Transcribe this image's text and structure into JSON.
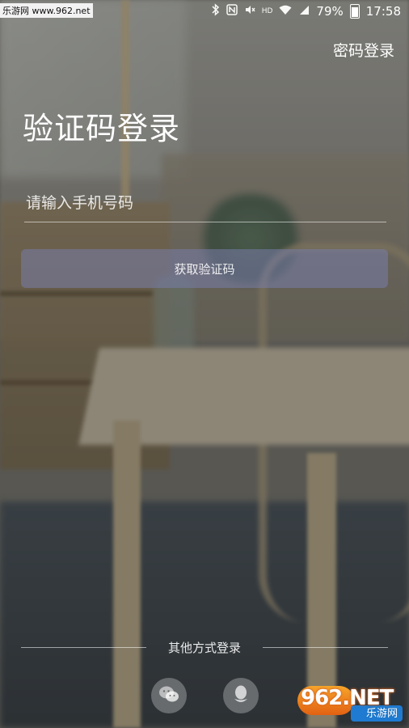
{
  "status_bar": {
    "watermark": "乐游网 www.962.net",
    "battery": "79%",
    "time": "17:58",
    "network": "HD",
    "icons": [
      "bluetooth-icon",
      "nfc-icon",
      "mute-icon",
      "wifi-icon",
      "signal-icon",
      "battery-icon"
    ]
  },
  "header": {
    "password_login_label": "密码登录"
  },
  "main": {
    "title": "验证码登录",
    "phone_placeholder": "请输入手机号码",
    "phone_value": "",
    "get_code_label": "获取验证码"
  },
  "footer": {
    "other_methods_label": "其他方式登录",
    "social": [
      "wechat-icon",
      "qq-icon"
    ]
  },
  "watermark_logo": {
    "big": "962.NET",
    "small": "乐游网"
  },
  "colors": {
    "button_bg": "#787eaa",
    "text": "#ffffff"
  }
}
